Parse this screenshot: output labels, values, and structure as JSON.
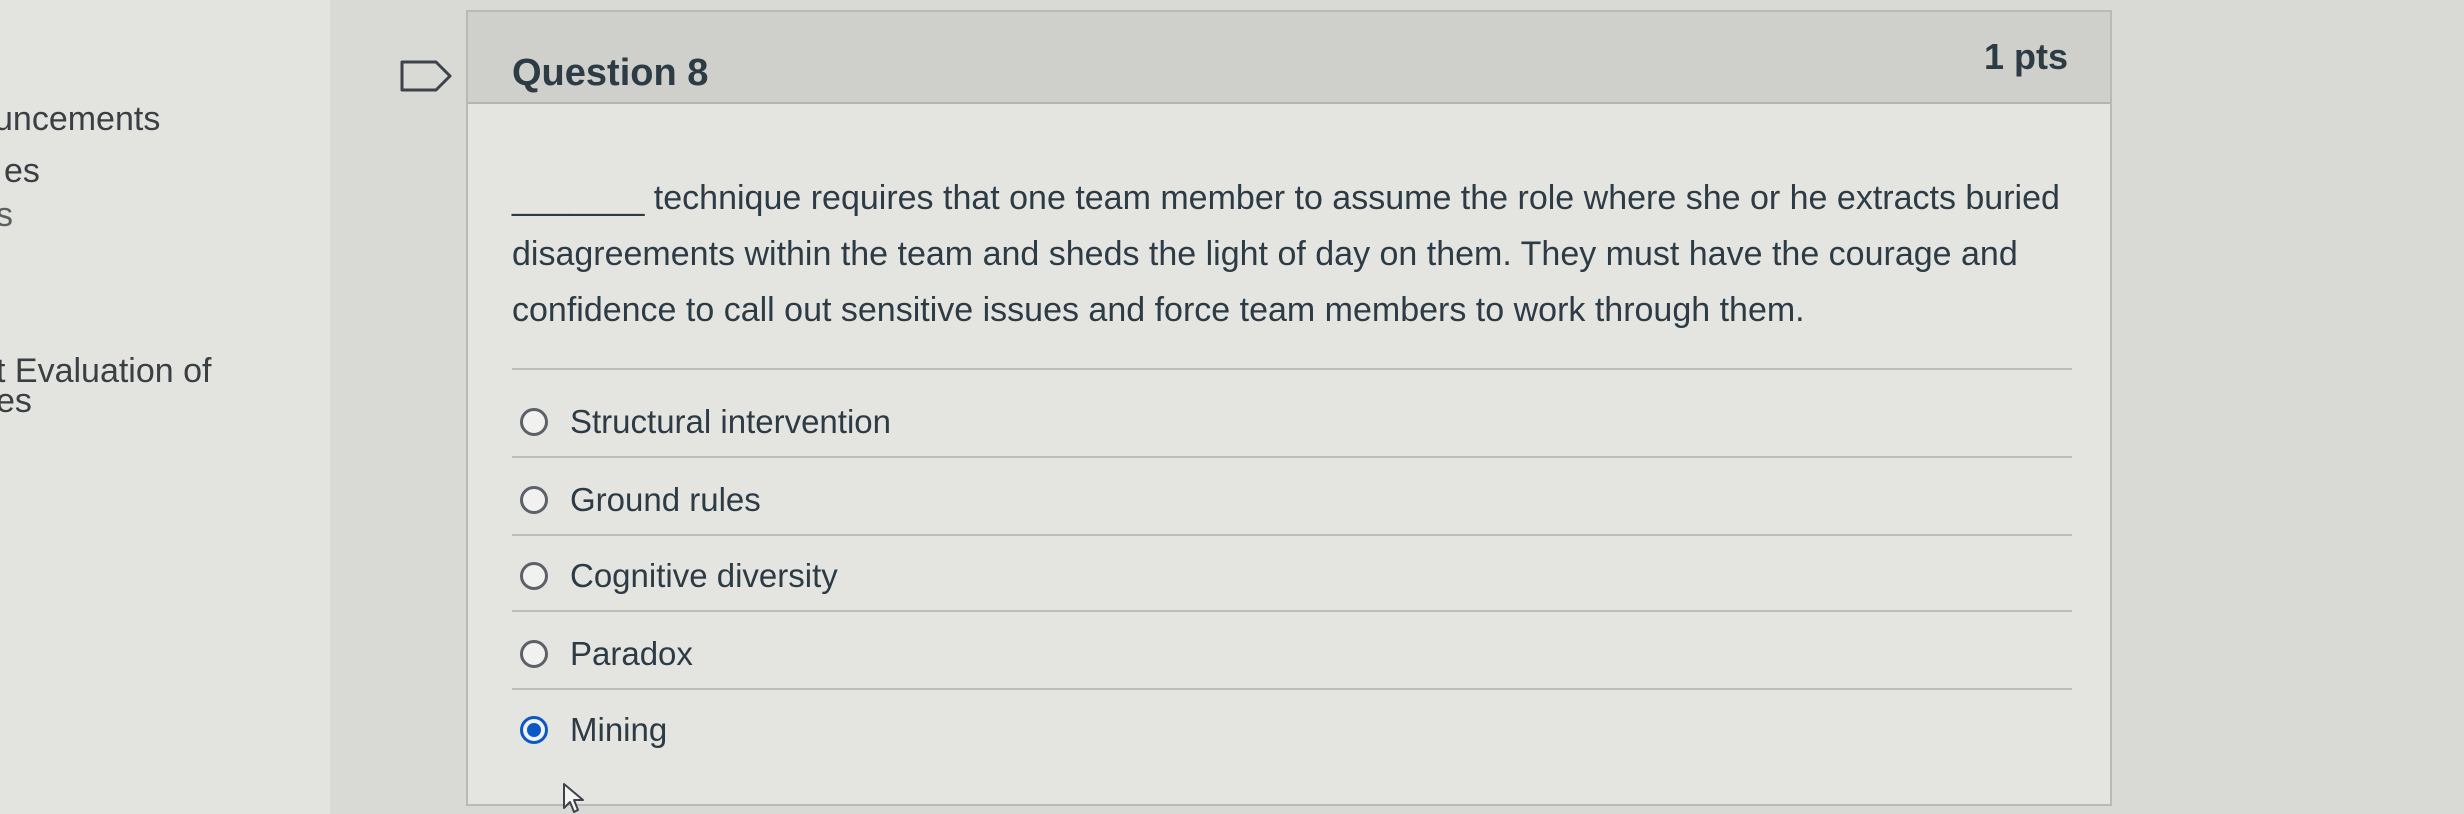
{
  "nav": {
    "items": [
      {
        "label": "uncements"
      },
      {
        "label": "es"
      },
      {
        "label": "s"
      },
      {
        "label": "t Evaluation of"
      },
      {
        "label": "es"
      }
    ]
  },
  "question": {
    "title": "Question 8",
    "points": "1 pts",
    "text": "_______ technique requires that one team member to assume the role where she or he extracts buried disagreements within the team and sheds the light of day on them. They must have the courage and confidence to call out sensitive issues and force team members to work through them.",
    "answers": [
      {
        "label": "Structural intervention",
        "selected": false
      },
      {
        "label": "Ground rules",
        "selected": false
      },
      {
        "label": "Cognitive diversity",
        "selected": false
      },
      {
        "label": "Paradox",
        "selected": false
      },
      {
        "label": "Mining",
        "selected": true
      }
    ]
  },
  "icons": {
    "flag": "flag-icon",
    "cursor": "mouse-cursor-icon"
  },
  "colors": {
    "accent": "#0a58c4",
    "text": "#2d3b45"
  }
}
